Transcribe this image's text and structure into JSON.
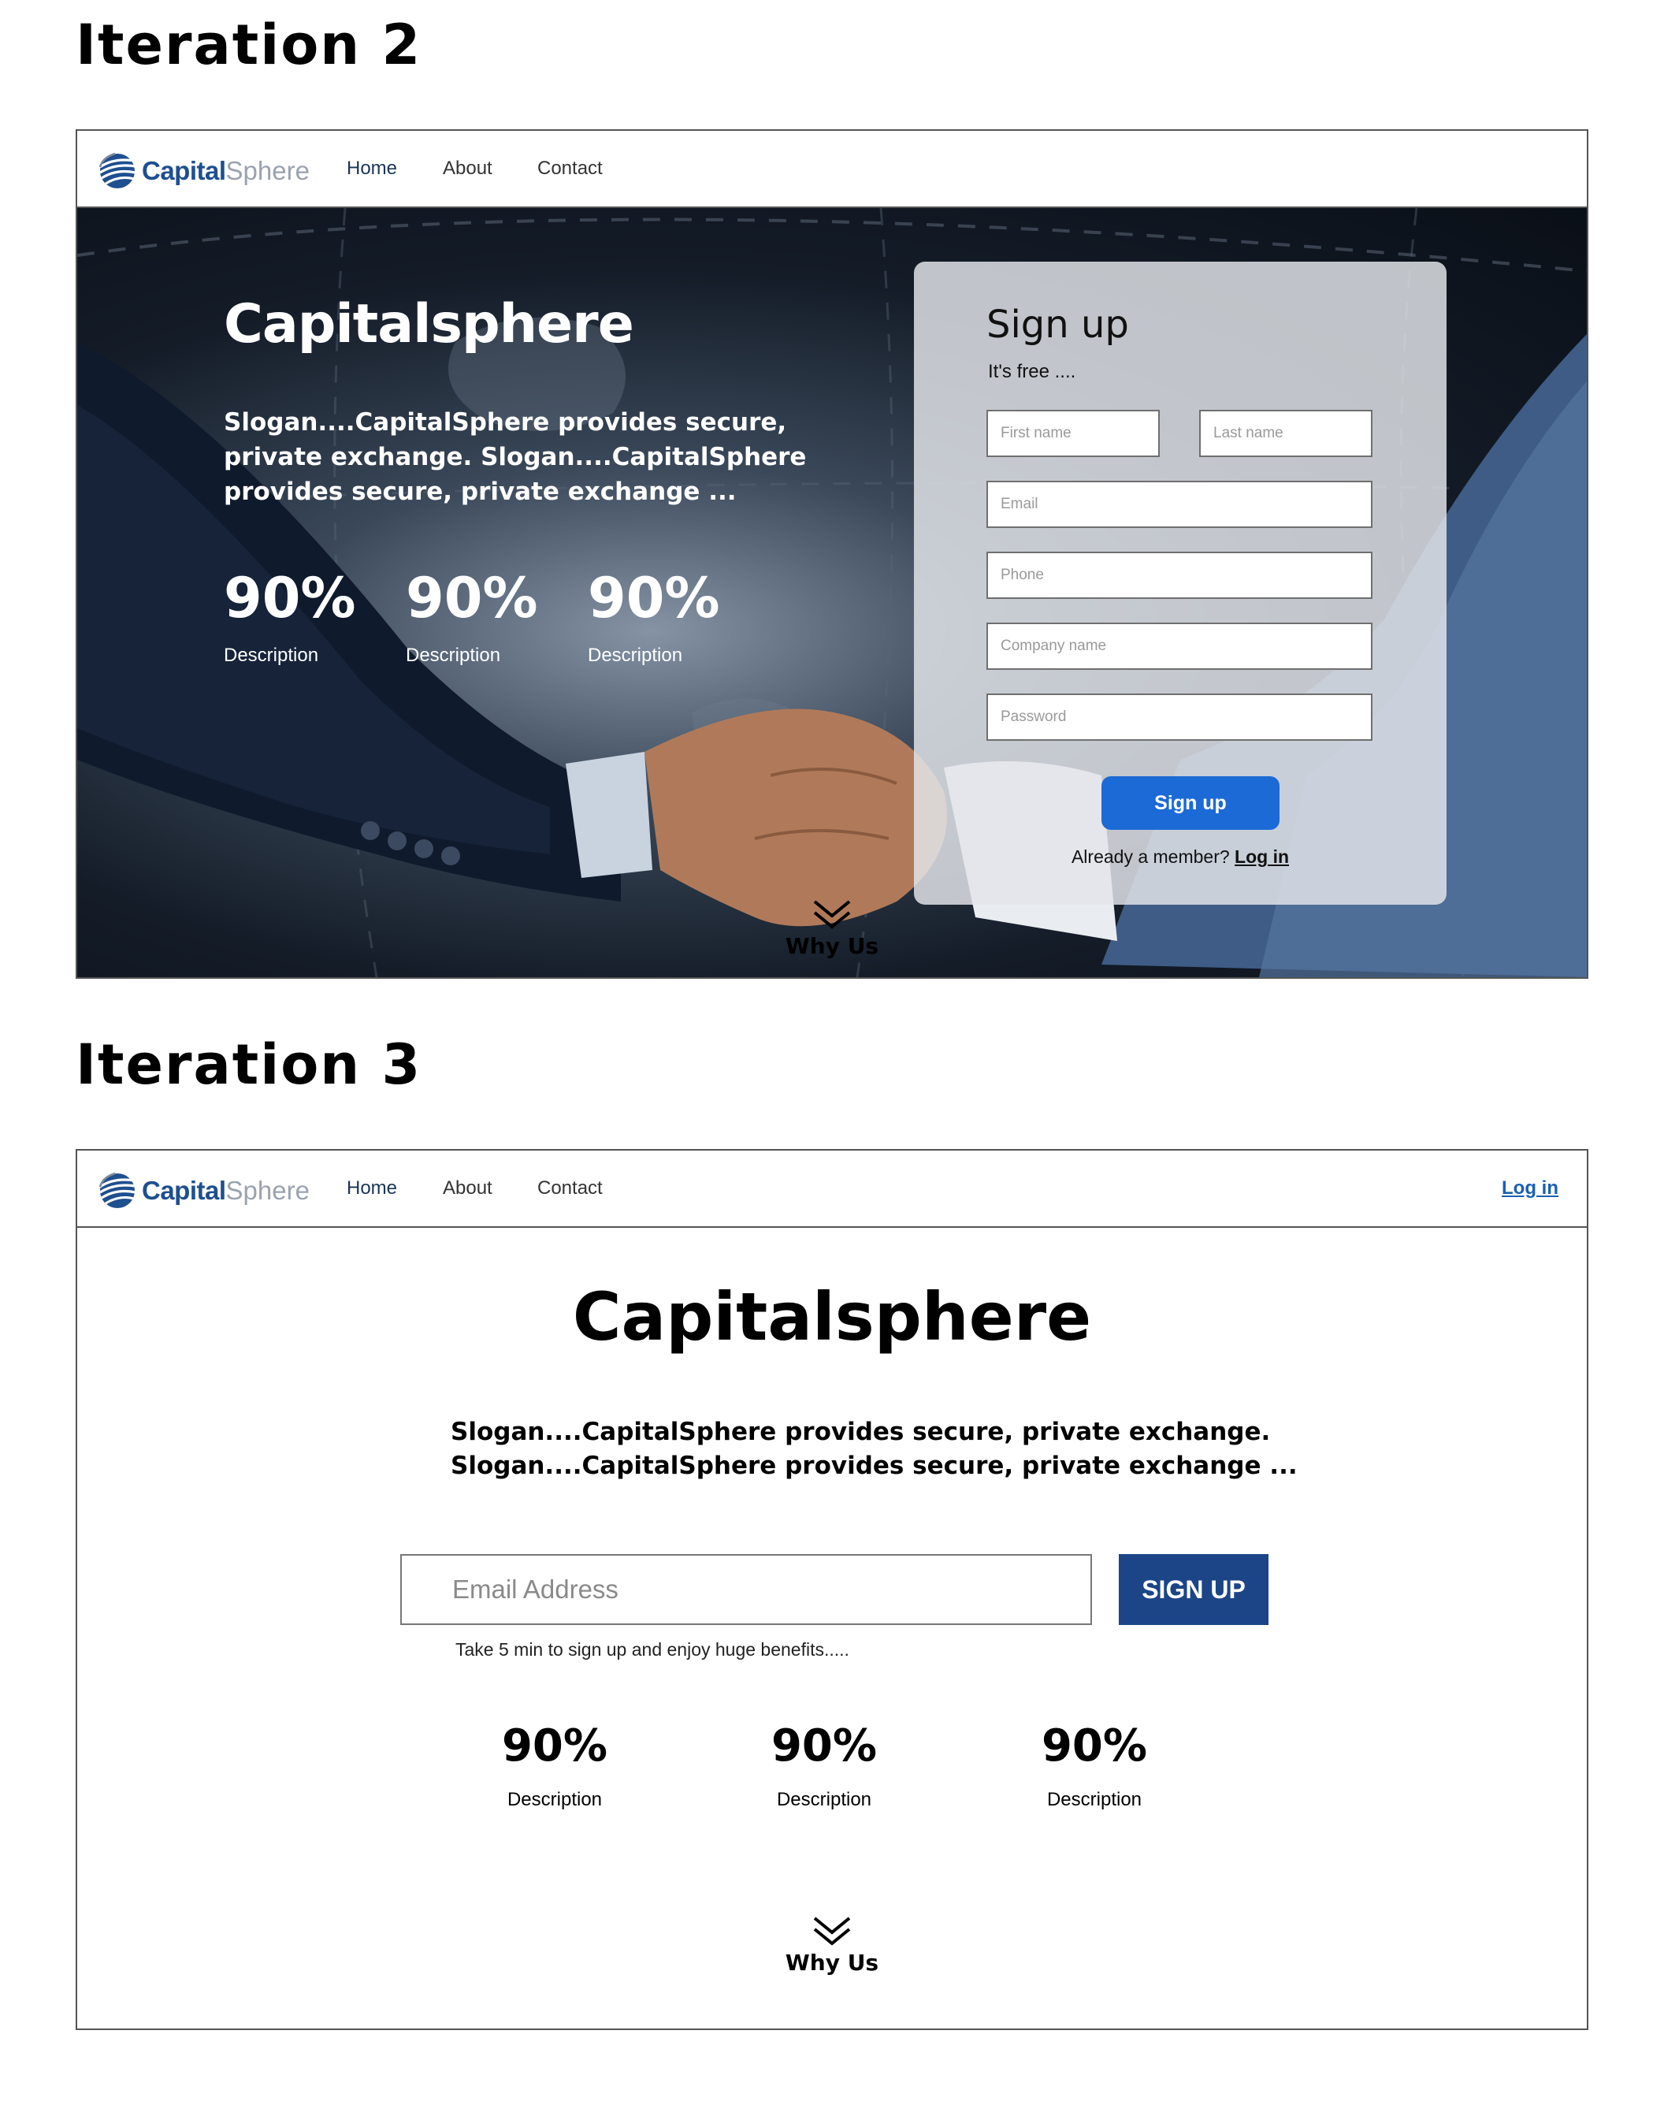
{
  "iteration2": {
    "heading": "Iteration 2",
    "nav": {
      "brand_capital": "Capital",
      "brand_sphere": "Sphere",
      "links": [
        "Home",
        "About",
        "Contact"
      ],
      "active": "Home"
    },
    "hero": {
      "title": "Capitalsphere",
      "slogan": "Slogan....CapitalSphere provides secure, private exchange. Slogan....CapitalSphere provides secure, private exchange ...",
      "stats": [
        {
          "value": "90%",
          "label": "Description"
        },
        {
          "value": "90%",
          "label": "Description"
        },
        {
          "value": "90%",
          "label": "Description"
        }
      ]
    },
    "signup": {
      "title": "Sign up",
      "subtitle": "It's free ....",
      "placeholders": {
        "first_name": "First name",
        "last_name": "Last name",
        "email": "Email",
        "phone": "Phone",
        "company": "Company name",
        "password": "Password"
      },
      "button": "Sign up",
      "member_text": "Already a member?",
      "login_link": "Log in",
      "button_color": "#1c6ad6"
    },
    "why_us": "Why Us"
  },
  "iteration3": {
    "heading": "Iteration 3",
    "nav": {
      "brand_capital": "Capital",
      "brand_sphere": "Sphere",
      "links": [
        "Home",
        "About",
        "Contact"
      ],
      "active": "Home",
      "login": "Log in"
    },
    "title": "Capitalsphere",
    "slogan_lines": [
      "Slogan....CapitalSphere provides secure, private exchange.",
      "Slogan....CapitalSphere provides secure, private exchange ..."
    ],
    "email_placeholder": "Email Address",
    "signup_button": "SIGN UP",
    "hint": "Take 5 min to sign up and enjoy huge benefits.....",
    "stats": [
      {
        "value": "90%",
        "label": "Description"
      },
      {
        "value": "90%",
        "label": "Description"
      },
      {
        "value": "90%",
        "label": "Description"
      }
    ],
    "why_us": "Why Us",
    "button_color": "#1b4587"
  },
  "colors": {
    "brand_blue": "#1e4f8f",
    "link_blue": "#1a5fb4"
  }
}
